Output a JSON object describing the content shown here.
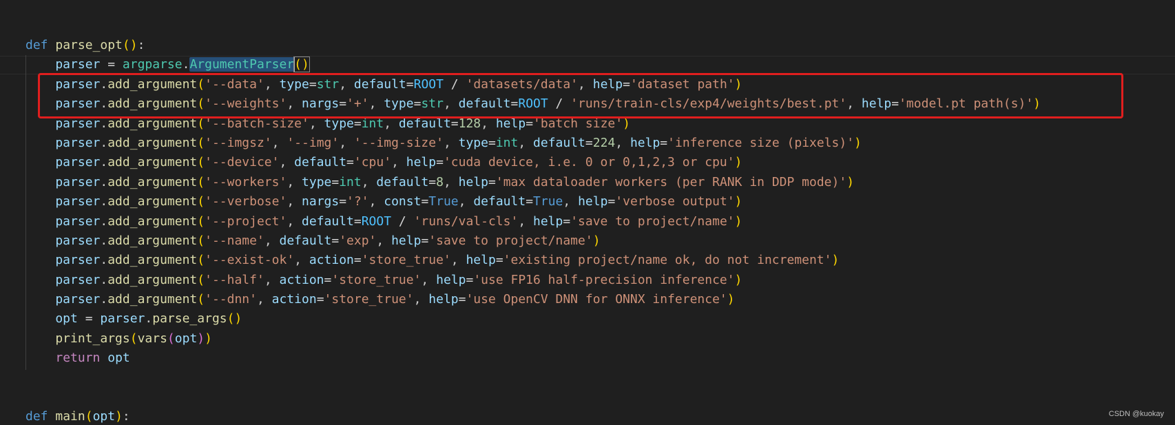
{
  "editor": {
    "language": "python",
    "colors": {
      "background": "#1f1f1f",
      "keyword": "#569cd6",
      "control_keyword": "#c586c0",
      "function": "#dcdcaa",
      "variable": "#9cdcfe",
      "string": "#ce9178",
      "class": "#4ec9b0",
      "constant": "#4fc1ff",
      "number": "#b5cea8",
      "bracket_1": "#ffd700",
      "bracket_2": "#da70d6",
      "highlight_box": "#e01e1e"
    },
    "highlight_box_lines": [
      2,
      3
    ],
    "lines": [
      {
        "tokens": [
          {
            "t": "def",
            "c": "kw"
          },
          {
            "t": " ",
            "c": "plain"
          },
          {
            "t": "parse_opt",
            "c": "fn"
          },
          {
            "t": "()",
            "c": "br1"
          },
          {
            "t": ":",
            "c": "plain"
          }
        ]
      },
      {
        "tokens": [
          {
            "t": "    parser",
            "c": "var"
          },
          {
            "t": " = ",
            "c": "op"
          },
          {
            "t": "argparse",
            "c": "cls"
          },
          {
            "t": ".",
            "c": "plain"
          },
          {
            "t": "ArgumentParser",
            "c": "cls"
          },
          {
            "t": "()",
            "c": "br1"
          }
        ]
      },
      {
        "tokens": [
          {
            "t": "    parser",
            "c": "var"
          },
          {
            "t": ".",
            "c": "plain"
          },
          {
            "t": "add_argument",
            "c": "fn"
          },
          {
            "t": "(",
            "c": "br1"
          },
          {
            "t": "'--data'",
            "c": "str"
          },
          {
            "t": ", ",
            "c": "plain"
          },
          {
            "t": "type",
            "c": "var"
          },
          {
            "t": "=",
            "c": "op"
          },
          {
            "t": "str",
            "c": "cls"
          },
          {
            "t": ", ",
            "c": "plain"
          },
          {
            "t": "default",
            "c": "var"
          },
          {
            "t": "=",
            "c": "op"
          },
          {
            "t": "ROOT",
            "c": "const"
          },
          {
            "t": " / ",
            "c": "op"
          },
          {
            "t": "'datasets/data'",
            "c": "str"
          },
          {
            "t": ", ",
            "c": "plain"
          },
          {
            "t": "help",
            "c": "var"
          },
          {
            "t": "=",
            "c": "op"
          },
          {
            "t": "'dataset path'",
            "c": "str"
          },
          {
            "t": ")",
            "c": "br1"
          }
        ]
      },
      {
        "tokens": [
          {
            "t": "    parser",
            "c": "var"
          },
          {
            "t": ".",
            "c": "plain"
          },
          {
            "t": "add_argument",
            "c": "fn"
          },
          {
            "t": "(",
            "c": "br1"
          },
          {
            "t": "'--weights'",
            "c": "str"
          },
          {
            "t": ", ",
            "c": "plain"
          },
          {
            "t": "nargs",
            "c": "var"
          },
          {
            "t": "=",
            "c": "op"
          },
          {
            "t": "'+'",
            "c": "str"
          },
          {
            "t": ", ",
            "c": "plain"
          },
          {
            "t": "type",
            "c": "var"
          },
          {
            "t": "=",
            "c": "op"
          },
          {
            "t": "str",
            "c": "cls"
          },
          {
            "t": ", ",
            "c": "plain"
          },
          {
            "t": "default",
            "c": "var"
          },
          {
            "t": "=",
            "c": "op"
          },
          {
            "t": "ROOT",
            "c": "const"
          },
          {
            "t": " / ",
            "c": "op"
          },
          {
            "t": "'runs/train-cls/exp4/weights/best.pt'",
            "c": "str"
          },
          {
            "t": ", ",
            "c": "plain"
          },
          {
            "t": "help",
            "c": "var"
          },
          {
            "t": "=",
            "c": "op"
          },
          {
            "t": "'model.pt path(s)'",
            "c": "str"
          },
          {
            "t": ")",
            "c": "br1"
          }
        ]
      },
      {
        "tokens": [
          {
            "t": "    parser",
            "c": "var"
          },
          {
            "t": ".",
            "c": "plain"
          },
          {
            "t": "add_argument",
            "c": "fn"
          },
          {
            "t": "(",
            "c": "br1"
          },
          {
            "t": "'--batch-size'",
            "c": "str"
          },
          {
            "t": ", ",
            "c": "plain"
          },
          {
            "t": "type",
            "c": "var"
          },
          {
            "t": "=",
            "c": "op"
          },
          {
            "t": "int",
            "c": "cls"
          },
          {
            "t": ", ",
            "c": "plain"
          },
          {
            "t": "default",
            "c": "var"
          },
          {
            "t": "=",
            "c": "op"
          },
          {
            "t": "128",
            "c": "num"
          },
          {
            "t": ", ",
            "c": "plain"
          },
          {
            "t": "help",
            "c": "var"
          },
          {
            "t": "=",
            "c": "op"
          },
          {
            "t": "'batch size'",
            "c": "str"
          },
          {
            "t": ")",
            "c": "br1"
          }
        ]
      },
      {
        "tokens": [
          {
            "t": "    parser",
            "c": "var"
          },
          {
            "t": ".",
            "c": "plain"
          },
          {
            "t": "add_argument",
            "c": "fn"
          },
          {
            "t": "(",
            "c": "br1"
          },
          {
            "t": "'--imgsz'",
            "c": "str"
          },
          {
            "t": ", ",
            "c": "plain"
          },
          {
            "t": "'--img'",
            "c": "str"
          },
          {
            "t": ", ",
            "c": "plain"
          },
          {
            "t": "'--img-size'",
            "c": "str"
          },
          {
            "t": ", ",
            "c": "plain"
          },
          {
            "t": "type",
            "c": "var"
          },
          {
            "t": "=",
            "c": "op"
          },
          {
            "t": "int",
            "c": "cls"
          },
          {
            "t": ", ",
            "c": "plain"
          },
          {
            "t": "default",
            "c": "var"
          },
          {
            "t": "=",
            "c": "op"
          },
          {
            "t": "224",
            "c": "num"
          },
          {
            "t": ", ",
            "c": "plain"
          },
          {
            "t": "help",
            "c": "var"
          },
          {
            "t": "=",
            "c": "op"
          },
          {
            "t": "'inference size (pixels)'",
            "c": "str"
          },
          {
            "t": ")",
            "c": "br1"
          }
        ]
      },
      {
        "tokens": [
          {
            "t": "    parser",
            "c": "var"
          },
          {
            "t": ".",
            "c": "plain"
          },
          {
            "t": "add_argument",
            "c": "fn"
          },
          {
            "t": "(",
            "c": "br1"
          },
          {
            "t": "'--device'",
            "c": "str"
          },
          {
            "t": ", ",
            "c": "plain"
          },
          {
            "t": "default",
            "c": "var"
          },
          {
            "t": "=",
            "c": "op"
          },
          {
            "t": "'cpu'",
            "c": "str"
          },
          {
            "t": ", ",
            "c": "plain"
          },
          {
            "t": "help",
            "c": "var"
          },
          {
            "t": "=",
            "c": "op"
          },
          {
            "t": "'cuda device, i.e. 0 or 0,1,2,3 or cpu'",
            "c": "str"
          },
          {
            "t": ")",
            "c": "br1"
          }
        ]
      },
      {
        "tokens": [
          {
            "t": "    parser",
            "c": "var"
          },
          {
            "t": ".",
            "c": "plain"
          },
          {
            "t": "add_argument",
            "c": "fn"
          },
          {
            "t": "(",
            "c": "br1"
          },
          {
            "t": "'--workers'",
            "c": "str"
          },
          {
            "t": ", ",
            "c": "plain"
          },
          {
            "t": "type",
            "c": "var"
          },
          {
            "t": "=",
            "c": "op"
          },
          {
            "t": "int",
            "c": "cls"
          },
          {
            "t": ", ",
            "c": "plain"
          },
          {
            "t": "default",
            "c": "var"
          },
          {
            "t": "=",
            "c": "op"
          },
          {
            "t": "8",
            "c": "num"
          },
          {
            "t": ", ",
            "c": "plain"
          },
          {
            "t": "help",
            "c": "var"
          },
          {
            "t": "=",
            "c": "op"
          },
          {
            "t": "'max dataloader workers (per RANK in DDP mode)'",
            "c": "str"
          },
          {
            "t": ")",
            "c": "br1"
          }
        ]
      },
      {
        "tokens": [
          {
            "t": "    parser",
            "c": "var"
          },
          {
            "t": ".",
            "c": "plain"
          },
          {
            "t": "add_argument",
            "c": "fn"
          },
          {
            "t": "(",
            "c": "br1"
          },
          {
            "t": "'--verbose'",
            "c": "str"
          },
          {
            "t": ", ",
            "c": "plain"
          },
          {
            "t": "nargs",
            "c": "var"
          },
          {
            "t": "=",
            "c": "op"
          },
          {
            "t": "'?'",
            "c": "str"
          },
          {
            "t": ", ",
            "c": "plain"
          },
          {
            "t": "const",
            "c": "var"
          },
          {
            "t": "=",
            "c": "op"
          },
          {
            "t": "True",
            "c": "kw"
          },
          {
            "t": ", ",
            "c": "plain"
          },
          {
            "t": "default",
            "c": "var"
          },
          {
            "t": "=",
            "c": "op"
          },
          {
            "t": "True",
            "c": "kw"
          },
          {
            "t": ", ",
            "c": "plain"
          },
          {
            "t": "help",
            "c": "var"
          },
          {
            "t": "=",
            "c": "op"
          },
          {
            "t": "'verbose output'",
            "c": "str"
          },
          {
            "t": ")",
            "c": "br1"
          }
        ]
      },
      {
        "tokens": [
          {
            "t": "    parser",
            "c": "var"
          },
          {
            "t": ".",
            "c": "plain"
          },
          {
            "t": "add_argument",
            "c": "fn"
          },
          {
            "t": "(",
            "c": "br1"
          },
          {
            "t": "'--project'",
            "c": "str"
          },
          {
            "t": ", ",
            "c": "plain"
          },
          {
            "t": "default",
            "c": "var"
          },
          {
            "t": "=",
            "c": "op"
          },
          {
            "t": "ROOT",
            "c": "const"
          },
          {
            "t": " / ",
            "c": "op"
          },
          {
            "t": "'runs/val-cls'",
            "c": "str"
          },
          {
            "t": ", ",
            "c": "plain"
          },
          {
            "t": "help",
            "c": "var"
          },
          {
            "t": "=",
            "c": "op"
          },
          {
            "t": "'save to project/name'",
            "c": "str"
          },
          {
            "t": ")",
            "c": "br1"
          }
        ]
      },
      {
        "tokens": [
          {
            "t": "    parser",
            "c": "var"
          },
          {
            "t": ".",
            "c": "plain"
          },
          {
            "t": "add_argument",
            "c": "fn"
          },
          {
            "t": "(",
            "c": "br1"
          },
          {
            "t": "'--name'",
            "c": "str"
          },
          {
            "t": ", ",
            "c": "plain"
          },
          {
            "t": "default",
            "c": "var"
          },
          {
            "t": "=",
            "c": "op"
          },
          {
            "t": "'exp'",
            "c": "str"
          },
          {
            "t": ", ",
            "c": "plain"
          },
          {
            "t": "help",
            "c": "var"
          },
          {
            "t": "=",
            "c": "op"
          },
          {
            "t": "'save to project/name'",
            "c": "str"
          },
          {
            "t": ")",
            "c": "br1"
          }
        ]
      },
      {
        "tokens": [
          {
            "t": "    parser",
            "c": "var"
          },
          {
            "t": ".",
            "c": "plain"
          },
          {
            "t": "add_argument",
            "c": "fn"
          },
          {
            "t": "(",
            "c": "br1"
          },
          {
            "t": "'--exist-ok'",
            "c": "str"
          },
          {
            "t": ", ",
            "c": "plain"
          },
          {
            "t": "action",
            "c": "var"
          },
          {
            "t": "=",
            "c": "op"
          },
          {
            "t": "'store_true'",
            "c": "str"
          },
          {
            "t": ", ",
            "c": "plain"
          },
          {
            "t": "help",
            "c": "var"
          },
          {
            "t": "=",
            "c": "op"
          },
          {
            "t": "'existing project/name ok, do not increment'",
            "c": "str"
          },
          {
            "t": ")",
            "c": "br1"
          }
        ]
      },
      {
        "tokens": [
          {
            "t": "    parser",
            "c": "var"
          },
          {
            "t": ".",
            "c": "plain"
          },
          {
            "t": "add_argument",
            "c": "fn"
          },
          {
            "t": "(",
            "c": "br1"
          },
          {
            "t": "'--half'",
            "c": "str"
          },
          {
            "t": ", ",
            "c": "plain"
          },
          {
            "t": "action",
            "c": "var"
          },
          {
            "t": "=",
            "c": "op"
          },
          {
            "t": "'store_true'",
            "c": "str"
          },
          {
            "t": ", ",
            "c": "plain"
          },
          {
            "t": "help",
            "c": "var"
          },
          {
            "t": "=",
            "c": "op"
          },
          {
            "t": "'use FP16 half-precision inference'",
            "c": "str"
          },
          {
            "t": ")",
            "c": "br1"
          }
        ]
      },
      {
        "tokens": [
          {
            "t": "    parser",
            "c": "var"
          },
          {
            "t": ".",
            "c": "plain"
          },
          {
            "t": "add_argument",
            "c": "fn"
          },
          {
            "t": "(",
            "c": "br1"
          },
          {
            "t": "'--dnn'",
            "c": "str"
          },
          {
            "t": ", ",
            "c": "plain"
          },
          {
            "t": "action",
            "c": "var"
          },
          {
            "t": "=",
            "c": "op"
          },
          {
            "t": "'store_true'",
            "c": "str"
          },
          {
            "t": ", ",
            "c": "plain"
          },
          {
            "t": "help",
            "c": "var"
          },
          {
            "t": "=",
            "c": "op"
          },
          {
            "t": "'use OpenCV DNN for ONNX inference'",
            "c": "str"
          },
          {
            "t": ")",
            "c": "br1"
          }
        ]
      },
      {
        "tokens": [
          {
            "t": "    opt",
            "c": "var"
          },
          {
            "t": " = ",
            "c": "op"
          },
          {
            "t": "parser",
            "c": "var"
          },
          {
            "t": ".",
            "c": "plain"
          },
          {
            "t": "parse_args",
            "c": "fn"
          },
          {
            "t": "()",
            "c": "br1"
          }
        ]
      },
      {
        "tokens": [
          {
            "t": "    print_args",
            "c": "fn"
          },
          {
            "t": "(",
            "c": "br1"
          },
          {
            "t": "vars",
            "c": "fn"
          },
          {
            "t": "(",
            "c": "br2"
          },
          {
            "t": "opt",
            "c": "var"
          },
          {
            "t": ")",
            "c": "br2"
          },
          {
            "t": ")",
            "c": "br1"
          }
        ]
      },
      {
        "tokens": [
          {
            "t": "    ",
            "c": "plain"
          },
          {
            "t": "return",
            "c": "ctl"
          },
          {
            "t": " ",
            "c": "plain"
          },
          {
            "t": "opt",
            "c": "var"
          }
        ]
      },
      {
        "tokens": [
          {
            "t": " ",
            "c": "plain"
          }
        ]
      },
      {
        "tokens": [
          {
            "t": " ",
            "c": "plain"
          }
        ]
      },
      {
        "tokens": [
          {
            "t": "def",
            "c": "kw"
          },
          {
            "t": " ",
            "c": "plain"
          },
          {
            "t": "main",
            "c": "fn"
          },
          {
            "t": "(",
            "c": "br1"
          },
          {
            "t": "opt",
            "c": "var"
          },
          {
            "t": ")",
            "c": "br1"
          },
          {
            "t": ":",
            "c": "plain"
          }
        ]
      }
    ]
  },
  "watermark": "CSDN @kuokay"
}
